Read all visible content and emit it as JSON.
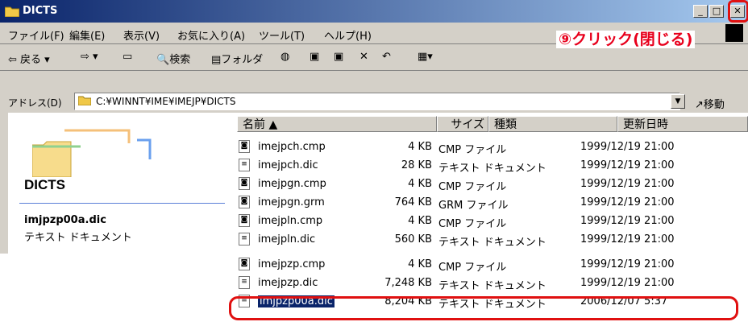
{
  "window": {
    "title": "DICTS"
  },
  "menu": [
    "ファイル(F)",
    "編集(E)",
    "表示(V)",
    "お気に入り(A)",
    "ツール(T)",
    "ヘルプ(H)"
  ],
  "annotation": "⑨クリック(閉じる)",
  "toolbar": {
    "back": "戻る",
    "search": "検索",
    "folders": "フォルダ"
  },
  "address": {
    "label": "アドレス(D)",
    "path": "C:¥WINNT¥IME¥IMEJP¥DICTS",
    "go": "移動"
  },
  "left_pane": {
    "folder_title": "DICTS",
    "selected_name": "imjpzp00a.dic",
    "selected_type": "テキスト ドキュメント"
  },
  "columns": {
    "name": "名前",
    "size": "サイズ",
    "type": "種類",
    "date": "更新日時"
  },
  "files": [
    {
      "name": "imejpch.cmp",
      "size": "4 KB",
      "type": "CMP ファイル",
      "date": "1999/12/19 21:00"
    },
    {
      "name": "imejpch.dic",
      "size": "28 KB",
      "type": "テキスト ドキュメント",
      "date": "1999/12/19 21:00"
    },
    {
      "name": "imejpgn.cmp",
      "size": "4 KB",
      "type": "CMP ファイル",
      "date": "1999/12/19 21:00"
    },
    {
      "name": "imejpgn.grm",
      "size": "764 KB",
      "type": "GRM ファイル",
      "date": "1999/12/19 21:00"
    },
    {
      "name": "imejpln.cmp",
      "size": "4 KB",
      "type": "CMP ファイル",
      "date": "1999/12/19 21:00"
    },
    {
      "name": "imejpln.dic",
      "size": "560 KB",
      "type": "テキスト ドキュメント",
      "date": "1999/12/19 21:00"
    },
    {
      "name": "imejpzp.cmp",
      "size": "4 KB",
      "type": "CMP ファイル",
      "date": "1999/12/19 21:00"
    },
    {
      "name": "imejpzp.dic",
      "size": "7,248 KB",
      "type": "テキスト ドキュメント",
      "date": "1999/12/19 21:00"
    },
    {
      "name": "imjpzp00a.dic",
      "size": "8,204 KB",
      "type": "テキスト ドキュメント",
      "date": "2006/12/07 5:37"
    }
  ],
  "colors": {
    "title_start": "#0a246a",
    "title_end": "#a6caf0",
    "highlight": "#e01010",
    "annotation": "#e8001c"
  }
}
